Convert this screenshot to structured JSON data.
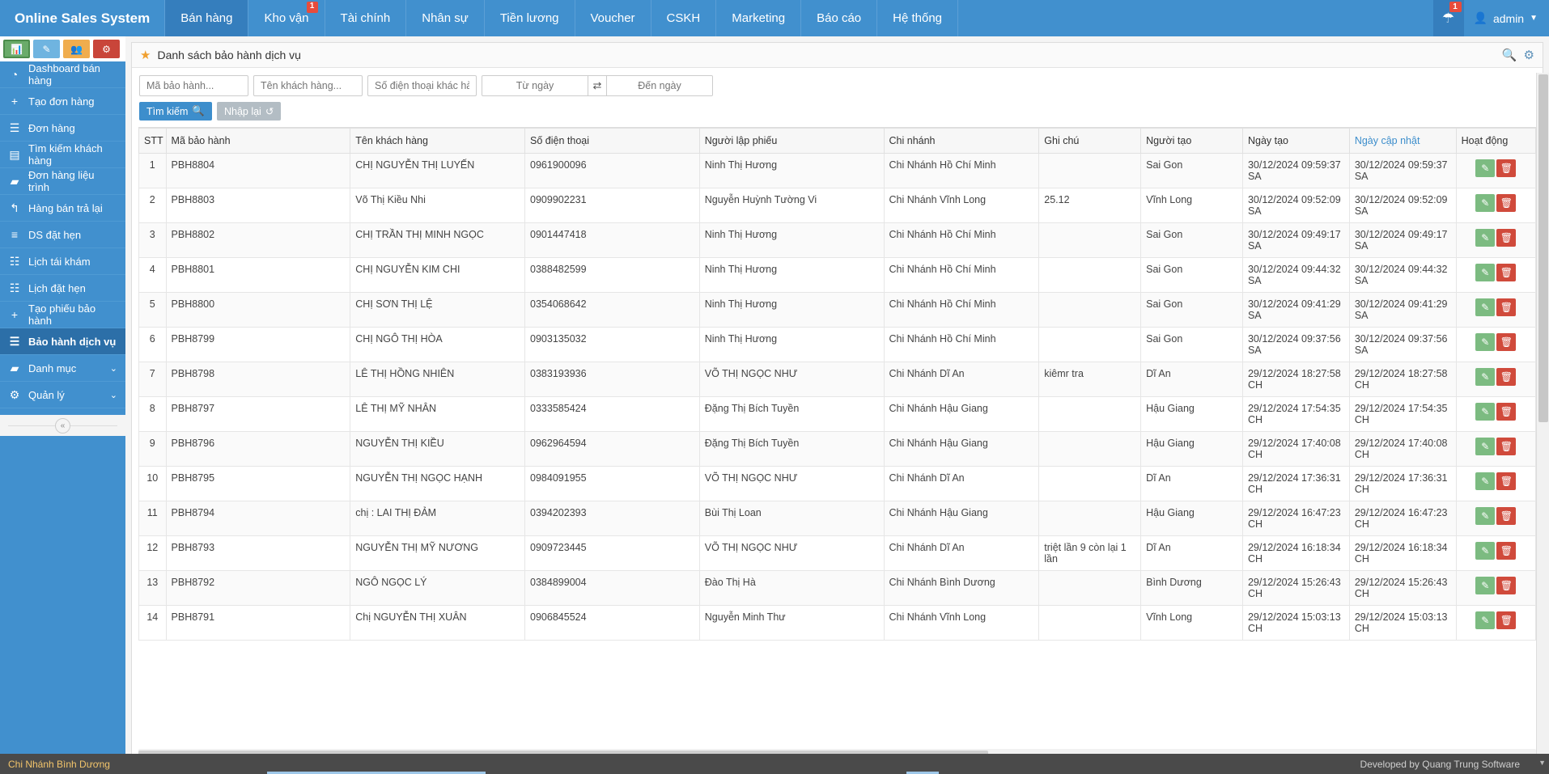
{
  "topnav": {
    "brand": "Online Sales System",
    "items": [
      {
        "label": "Bán hàng",
        "active": true,
        "badge": ""
      },
      {
        "label": "Kho vận",
        "active": false,
        "badge": "1"
      },
      {
        "label": "Tài chính",
        "active": false,
        "badge": ""
      },
      {
        "label": "Nhân sự",
        "active": false,
        "badge": ""
      },
      {
        "label": "Tiền lương",
        "active": false,
        "badge": ""
      },
      {
        "label": "Voucher",
        "active": false,
        "badge": ""
      },
      {
        "label": "CSKH",
        "active": false,
        "badge": ""
      },
      {
        "label": "Marketing",
        "active": false,
        "badge": ""
      },
      {
        "label": "Báo cáo",
        "active": false,
        "badge": ""
      },
      {
        "label": "Hệ thống",
        "active": false,
        "badge": ""
      }
    ],
    "notification_badge": "1",
    "user_label": "admin"
  },
  "sidebar": {
    "quick_buttons": [
      "chart-icon",
      "pencil-icon",
      "users-icon",
      "cogs-icon"
    ],
    "items": [
      {
        "label": "Dashboard bán hàng",
        "icon": "dashboard-icon",
        "active": false,
        "chevron": ""
      },
      {
        "label": "Tạo đơn hàng",
        "icon": "plus-icon",
        "active": false,
        "chevron": ""
      },
      {
        "label": "Đơn hàng",
        "icon": "document-icon",
        "active": false,
        "chevron": ""
      },
      {
        "label": "Tìm kiếm khách hàng",
        "icon": "contact-icon",
        "active": false,
        "chevron": ""
      },
      {
        "label": "Đơn hàng liệu trình",
        "icon": "folder-icon",
        "active": false,
        "chevron": ""
      },
      {
        "label": "Hàng bán trả lại",
        "icon": "reply-all-icon",
        "active": false,
        "chevron": ""
      },
      {
        "label": "DS đặt hẹn",
        "icon": "list-icon",
        "active": false,
        "chevron": ""
      },
      {
        "label": "Lịch tái khám",
        "icon": "calendar-icon",
        "active": false,
        "chevron": ""
      },
      {
        "label": "Lịch đặt hẹn",
        "icon": "calendar-icon",
        "active": false,
        "chevron": ""
      },
      {
        "label": "Tạo phiếu bảo hành",
        "icon": "plus-icon",
        "active": false,
        "chevron": ""
      },
      {
        "label": "Bảo hành dịch vụ",
        "icon": "document-icon",
        "active": true,
        "chevron": ""
      },
      {
        "label": "Danh mục",
        "icon": "folder-icon",
        "active": false,
        "chevron": "⌄"
      },
      {
        "label": "Quản lý",
        "icon": "gear-icon",
        "active": false,
        "chevron": "⌄"
      }
    ],
    "collapse_glyph": "«"
  },
  "panel": {
    "title": "Danh sách bảo hành dịch vụ",
    "star_icon": "star-icon",
    "header_icons": [
      "search-icon",
      "gear-icon"
    ]
  },
  "filters": {
    "code_placeholder": "Mã bảo hành...",
    "code_value": "",
    "customer_placeholder": "Tên khách hàng...",
    "customer_value": "",
    "phone_placeholder": "Số điện thoại khác hàng",
    "phone_value": "",
    "date_from_placeholder": "Từ ngày",
    "date_from_value": "",
    "date_to_placeholder": "Đến ngày",
    "date_to_value": "",
    "swap_icon": "swap-icon",
    "search_button": "Tìm kiếm",
    "reset_button": "Nhập lại"
  },
  "table": {
    "columns": [
      {
        "key": "stt",
        "label": "STT"
      },
      {
        "key": "code",
        "label": "Mã bảo hành"
      },
      {
        "key": "customer",
        "label": "Tên khách hàng"
      },
      {
        "key": "phone",
        "label": "Số điện thoại"
      },
      {
        "key": "creator_slip",
        "label": "Người lập phiếu"
      },
      {
        "key": "branch",
        "label": "Chi nhánh"
      },
      {
        "key": "note",
        "label": "Ghi chú"
      },
      {
        "key": "created_by",
        "label": "Người tạo"
      },
      {
        "key": "created_at",
        "label": "Ngày tạo"
      },
      {
        "key": "updated_at",
        "label": "Ngày cập nhật",
        "sorted": true
      },
      {
        "key": "actions",
        "label": "Hoạt động"
      }
    ],
    "rows": [
      {
        "stt": "1",
        "code": "PBH8804",
        "customer": "CHỊ NGUYỄN THỊ LUYẾN",
        "phone": "0961900096",
        "creator_slip": "Ninh Thị Hương",
        "branch": "Chi Nhánh Hồ Chí Minh",
        "note": "",
        "created_by": "Sai Gon",
        "created_at": "30/12/2024 09:59:37 SA",
        "updated_at": "30/12/2024 09:59:37 SA"
      },
      {
        "stt": "2",
        "code": "PBH8803",
        "customer": "Võ Thị Kiều Nhi",
        "phone": "0909902231",
        "creator_slip": "Nguyễn Huỳnh Tường Vi",
        "branch": "Chi Nhánh Vĩnh Long",
        "note": "25.12",
        "created_by": "Vĩnh Long",
        "created_at": "30/12/2024 09:52:09 SA",
        "updated_at": "30/12/2024 09:52:09 SA"
      },
      {
        "stt": "3",
        "code": "PBH8802",
        "customer": "CHỊ TRẦN THỊ MINH NGỌC",
        "phone": "0901447418",
        "creator_slip": "Ninh Thị Hương",
        "branch": "Chi Nhánh Hồ Chí Minh",
        "note": "",
        "created_by": "Sai Gon",
        "created_at": "30/12/2024 09:49:17 SA",
        "updated_at": "30/12/2024 09:49:17 SA"
      },
      {
        "stt": "4",
        "code": "PBH8801",
        "customer": "CHỊ NGUYỄN KIM CHI",
        "phone": "0388482599",
        "creator_slip": "Ninh Thị Hương",
        "branch": "Chi Nhánh Hồ Chí Minh",
        "note": "",
        "created_by": "Sai Gon",
        "created_at": "30/12/2024 09:44:32 SA",
        "updated_at": "30/12/2024 09:44:32 SA"
      },
      {
        "stt": "5",
        "code": "PBH8800",
        "customer": "CHỊ SƠN THỊ LỆ",
        "phone": "0354068642",
        "creator_slip": "Ninh Thị Hương",
        "branch": "Chi Nhánh Hồ Chí Minh",
        "note": "",
        "created_by": "Sai Gon",
        "created_at": "30/12/2024 09:41:29 SA",
        "updated_at": "30/12/2024 09:41:29 SA"
      },
      {
        "stt": "6",
        "code": "PBH8799",
        "customer": "CHỊ NGÔ THỊ HÒA",
        "phone": "0903135032",
        "creator_slip": "Ninh Thị Hương",
        "branch": "Chi Nhánh Hồ Chí Minh",
        "note": "",
        "created_by": "Sai Gon",
        "created_at": "30/12/2024 09:37:56 SA",
        "updated_at": "30/12/2024 09:37:56 SA"
      },
      {
        "stt": "7",
        "code": "PBH8798",
        "customer": "LÊ THỊ HỒNG NHIÊN",
        "phone": "0383193936",
        "creator_slip": "VÕ THỊ NGỌC NHƯ",
        "branch": "Chi Nhánh Dĩ An",
        "note": "kiêmr tra",
        "created_by": "Dĩ An",
        "created_at": "29/12/2024 18:27:58 CH",
        "updated_at": "29/12/2024 18:27:58 CH"
      },
      {
        "stt": "8",
        "code": "PBH8797",
        "customer": "LÊ THỊ MỸ NHÂN",
        "phone": "0333585424",
        "creator_slip": "Đặng Thị Bích Tuyền",
        "branch": "Chi Nhánh Hậu Giang",
        "note": "",
        "created_by": "Hậu Giang",
        "created_at": "29/12/2024 17:54:35 CH",
        "updated_at": "29/12/2024 17:54:35 CH"
      },
      {
        "stt": "9",
        "code": "PBH8796",
        "customer": "NGUYỄN THỊ KIỀU",
        "phone": "0962964594",
        "creator_slip": "Đặng Thị Bích Tuyền",
        "branch": "Chi Nhánh Hậu Giang",
        "note": "",
        "created_by": "Hậu Giang",
        "created_at": "29/12/2024 17:40:08 CH",
        "updated_at": "29/12/2024 17:40:08 CH"
      },
      {
        "stt": "10",
        "code": "PBH8795",
        "customer": "NGUYỄN THỊ NGỌC HẠNH",
        "phone": "0984091955",
        "creator_slip": "VÕ THỊ NGỌC NHƯ",
        "branch": "Chi Nhánh Dĩ An",
        "note": "",
        "created_by": "Dĩ An",
        "created_at": "29/12/2024 17:36:31 CH",
        "updated_at": "29/12/2024 17:36:31 CH"
      },
      {
        "stt": "11",
        "code": "PBH8794",
        "customer": "chị : LAI THỊ ĐẢM",
        "phone": "0394202393",
        "creator_slip": "Bùi Thị Loan",
        "branch": "Chi Nhánh Hậu Giang",
        "note": "",
        "created_by": "Hậu Giang",
        "created_at": "29/12/2024 16:47:23 CH",
        "updated_at": "29/12/2024 16:47:23 CH"
      },
      {
        "stt": "12",
        "code": "PBH8793",
        "customer": "NGUYỄN THỊ MỸ NƯƠNG",
        "phone": "0909723445",
        "creator_slip": "VÕ THỊ NGỌC NHƯ",
        "branch": "Chi Nhánh Dĩ An",
        "note": "triệt lần 9 còn lại 1 lần",
        "created_by": "Dĩ An",
        "created_at": "29/12/2024 16:18:34 CH",
        "updated_at": "29/12/2024 16:18:34 CH"
      },
      {
        "stt": "13",
        "code": "PBH8792",
        "customer": "NGÔ NGỌC LÝ",
        "phone": "0384899004",
        "creator_slip": "Đào Thị Hà",
        "branch": "Chi Nhánh Bình Dương",
        "note": "",
        "created_by": "Bình Dương",
        "created_at": "29/12/2024 15:26:43 CH",
        "updated_at": "29/12/2024 15:26:43 CH"
      },
      {
        "stt": "14",
        "code": "PBH8791",
        "customer": "Chị NGUYỄN THỊ XUÂN",
        "phone": "0906845524",
        "creator_slip": "Nguyễn Minh Thư",
        "branch": "Chi Nhánh Vĩnh Long",
        "note": "",
        "created_by": "Vĩnh Long",
        "created_at": "29/12/2024 15:03:13 CH",
        "updated_at": "29/12/2024 15:03:13 CH"
      }
    ],
    "row_actions": {
      "edit_icon": "edit-icon",
      "delete_icon": "trash-icon"
    }
  },
  "footer": {
    "left": "Chi Nhánh Bình Dương",
    "right": "Developed by Quang Trung Software"
  },
  "colors": {
    "nav_blue": "#4190ce",
    "nav_active": "#357ebd",
    "link_blue": "#3d8ecc",
    "edit_green": "#7cbb81",
    "delete_red": "#d04a3b",
    "star_orange": "#f0a030",
    "footer_gray": "#4a4a4a",
    "footer_text": "#f3c56b"
  }
}
